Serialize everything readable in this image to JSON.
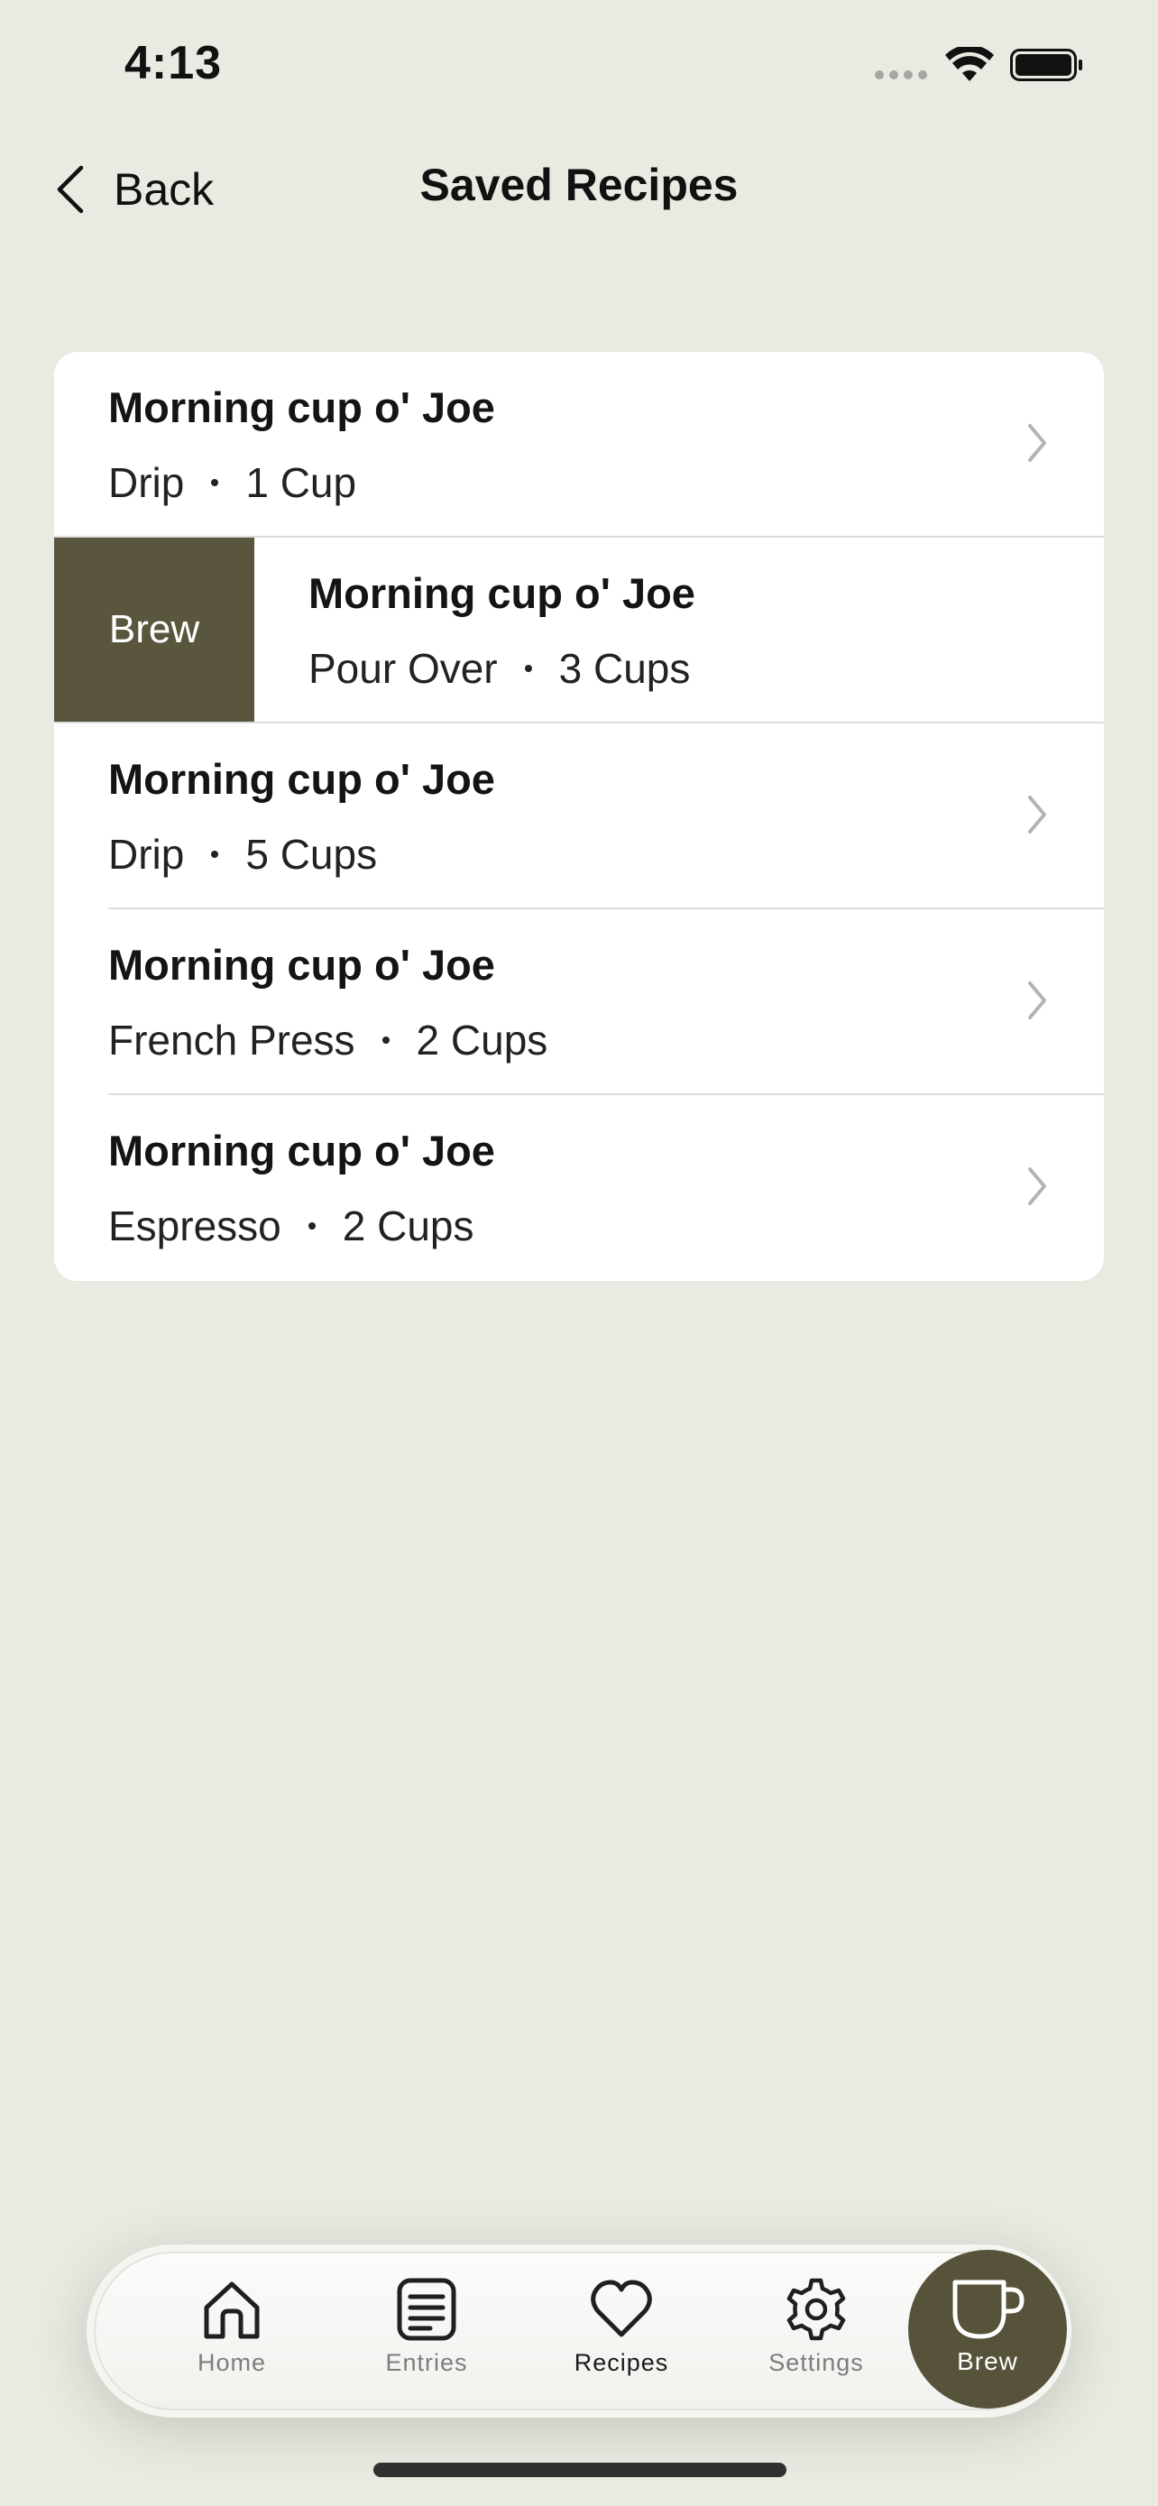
{
  "status_bar": {
    "time": "4:13"
  },
  "nav": {
    "back_label": "Back",
    "title": "Saved Recipes"
  },
  "recipes": [
    {
      "name": "Morning cup o' Joe",
      "method": "Drip",
      "cups": "1 Cup"
    },
    {
      "name": "Morning cup o' Joe",
      "method": "Pour Over",
      "cups": "3 Cups",
      "swipe_action": "Brew"
    },
    {
      "name": "Morning cup o' Joe",
      "method": "Drip",
      "cups": "5 Cups"
    },
    {
      "name": "Morning cup o' Joe",
      "method": "French Press",
      "cups": "2 Cups"
    },
    {
      "name": "Morning cup o' Joe",
      "method": "Espresso",
      "cups": "2 Cups"
    }
  ],
  "tab_bar": {
    "tabs": [
      {
        "label": "Home",
        "icon": "house-icon"
      },
      {
        "label": "Entries",
        "icon": "notes-icon"
      },
      {
        "label": "Recipes",
        "icon": "heart-icon",
        "active": true
      },
      {
        "label": "Settings",
        "icon": "gear-icon"
      }
    ],
    "brew_button": {
      "label": "Brew",
      "icon": "coffee-cup-icon"
    }
  },
  "colors": {
    "background": "#e8ebe2",
    "accent": "#57533a",
    "card": "#ffffff"
  }
}
